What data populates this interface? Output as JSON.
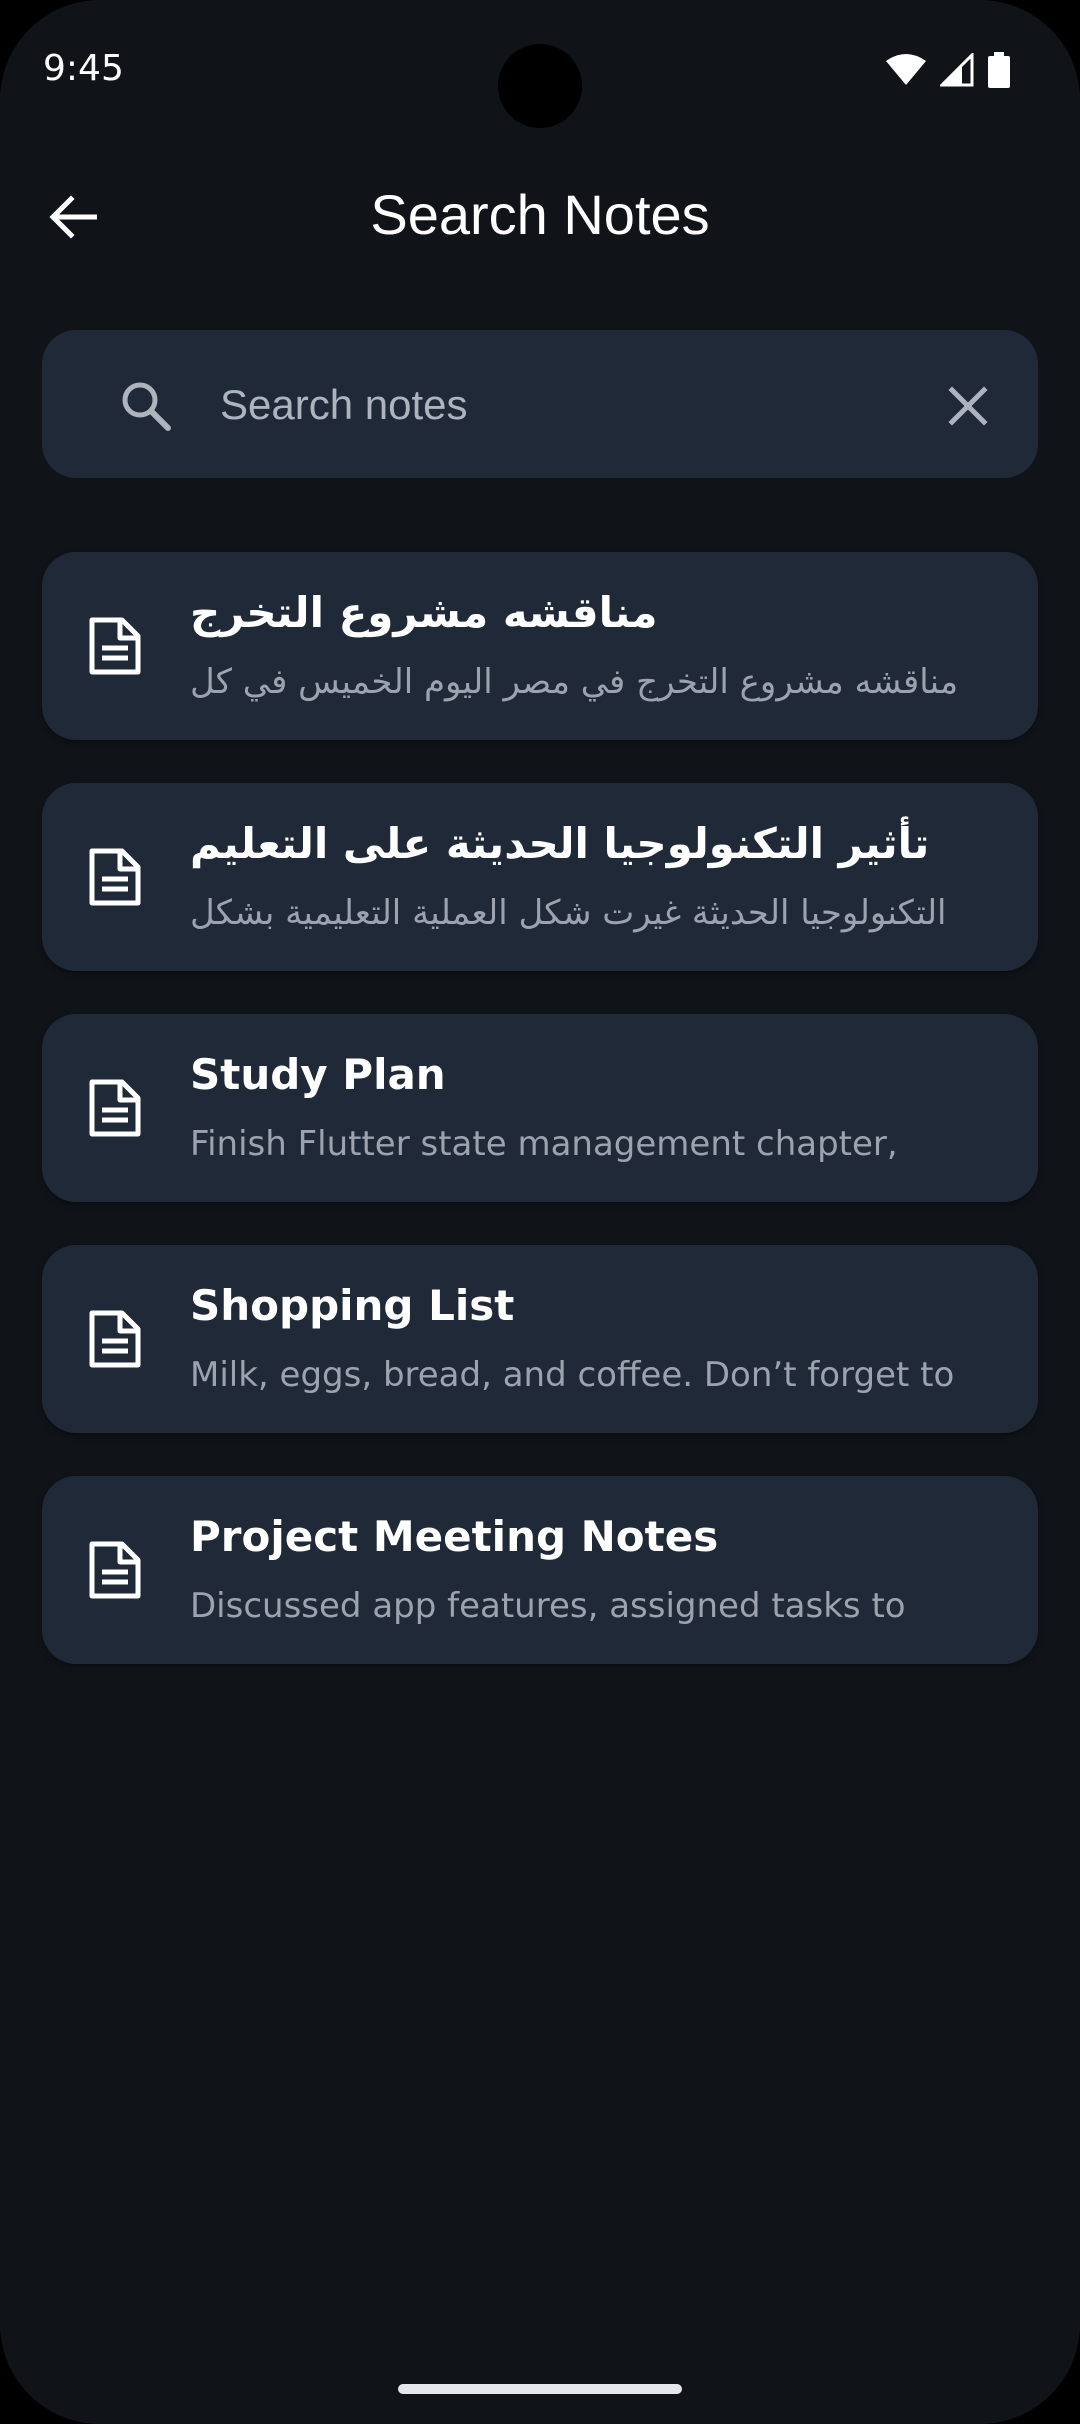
{
  "status_bar": {
    "time": "9:45",
    "icons": [
      "wifi-icon",
      "signal-icon",
      "battery-icon"
    ]
  },
  "app_bar": {
    "title": "Search Notes",
    "back_icon": "arrow-back-icon"
  },
  "search": {
    "placeholder": "Search notes",
    "value": "",
    "search_icon": "search-icon",
    "clear_icon": "close-icon"
  },
  "notes": [
    {
      "title": "مناقشه مشروع التخرج",
      "preview": "مناقشه مشروع التخرج في مصر اليوم الخميس في كل",
      "rtl": true,
      "icon": "document-icon"
    },
    {
      "title": "تأثير التكنولوجيا الحديثة على التعليم",
      "preview": "التكنولوجيا الحديثة غيرت شكل العملية التعليمية بشكل",
      "rtl": true,
      "icon": "document-icon"
    },
    {
      "title": "Study Plan",
      "preview": "Finish Flutter state management chapter,",
      "rtl": false,
      "icon": "document-icon"
    },
    {
      "title": "Shopping List",
      "preview": "Milk, eggs, bread, and coffee. Don’t forget to",
      "rtl": false,
      "icon": "document-icon"
    },
    {
      "title": "Project Meeting Notes",
      "preview": "Discussed app features, assigned tasks to",
      "rtl": false,
      "icon": "document-icon"
    }
  ],
  "colors": {
    "background": "#101418",
    "surface": "#1f2937",
    "text_primary": "#ffffff",
    "text_secondary": "#9ca3af"
  }
}
